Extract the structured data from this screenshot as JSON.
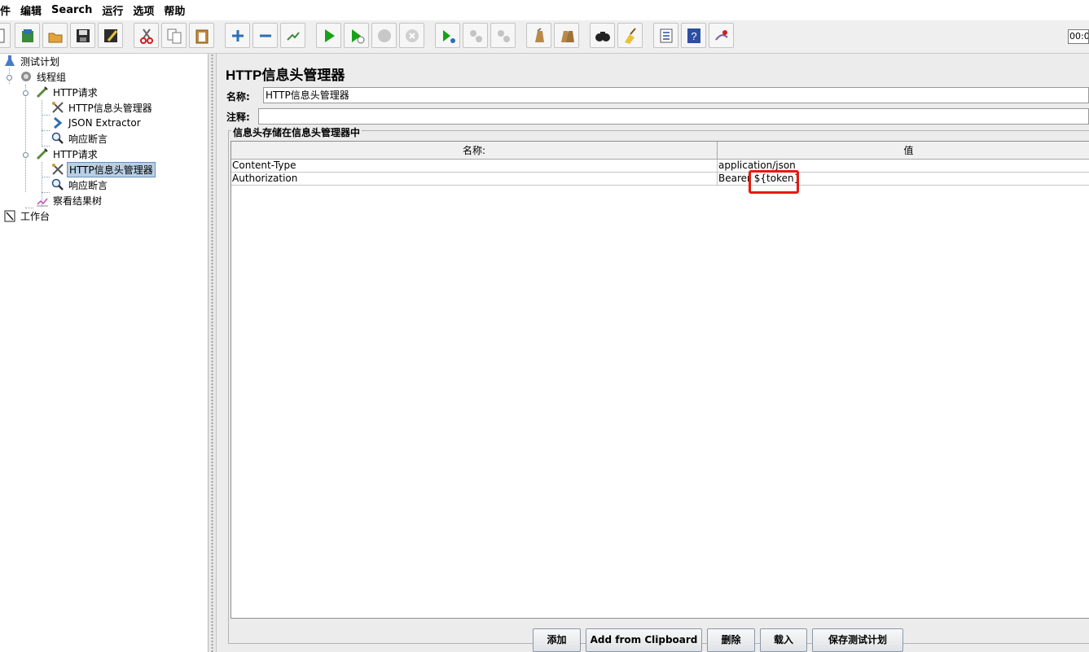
{
  "menu": [
    "件",
    "编辑",
    "Search",
    "运行",
    "选项",
    "帮助"
  ],
  "toolbar": {
    "icons": [
      "new-icon",
      "templates-icon",
      "open-icon",
      "save-icon",
      "save-as-icon",
      "cut-icon",
      "copy-icon",
      "paste-icon",
      "expand-icon",
      "collapse-icon",
      "toggle-icon",
      "start-icon",
      "start-no-pause-icon",
      "stop-icon",
      "shutdown-icon",
      "remote-start-icon",
      "remote-stop-icon",
      "remote-exit-icon",
      "clear-icon",
      "clear-all-icon",
      "search-icon",
      "reset-search-icon",
      "function-helper-icon",
      "help-icon",
      "logger-icon"
    ],
    "timer": "00:0"
  },
  "tree": {
    "nodes": [
      {
        "label": "测试计划",
        "icon": "test-plan-icon",
        "level": 0
      },
      {
        "label": "线程组",
        "icon": "thread-group-icon",
        "level": 1
      },
      {
        "label": "HTTP请求",
        "icon": "http-request-icon",
        "level": 2
      },
      {
        "label": "HTTP信息头管理器",
        "icon": "header-manager-icon",
        "level": 3
      },
      {
        "label": "JSON Extractor",
        "icon": "json-extractor-icon",
        "level": 3
      },
      {
        "label": "响应断言",
        "icon": "assertion-icon",
        "level": 3
      },
      {
        "label": "HTTP请求",
        "icon": "http-request-icon",
        "level": 2
      },
      {
        "label": "HTTP信息头管理器",
        "icon": "header-manager-icon",
        "level": 3,
        "selected": true
      },
      {
        "label": "响应断言",
        "icon": "assertion-icon",
        "level": 3
      },
      {
        "label": "察看结果树",
        "icon": "results-tree-icon",
        "level": 2
      },
      {
        "label": "工作台",
        "icon": "workbench-icon",
        "level": 0
      }
    ]
  },
  "panel": {
    "title": "HTTP信息头管理器",
    "name_label": "名称:",
    "name_value": "HTTP信息头管理器",
    "comment_label": "注释:",
    "comment_value": "",
    "group_title": "信息头存储在信息头管理器中",
    "table": {
      "columns": [
        "名称:",
        "值"
      ],
      "rows": [
        {
          "name": "Content-Type",
          "value": "application/json"
        },
        {
          "name": "Authorization",
          "value": "Bearer ${token}"
        }
      ]
    },
    "buttons": [
      "添加",
      "Add from Clipboard",
      "删除",
      "载入",
      "保存测试计划"
    ]
  },
  "colors": {
    "selection": "#b8cfe5",
    "highlight_box": "#e8190e",
    "panel_bg": "#ececec"
  }
}
